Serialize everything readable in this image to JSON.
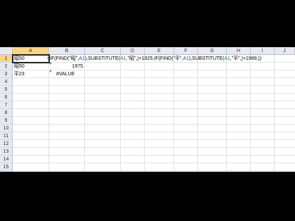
{
  "columns": [
    "A",
    "B",
    "C",
    "D",
    "E",
    "F",
    "G",
    "H",
    "I",
    "J"
  ],
  "rows": [
    "1",
    "2",
    "3",
    "4",
    "5",
    "6",
    "7",
    "8",
    "9",
    "10",
    "11",
    "12",
    "13",
    "14",
    "15",
    "16"
  ],
  "cells": {
    "A1": "昭50",
    "A2": "昭50",
    "A3": "平23",
    "B2": "1975",
    "B3": "#VALUE"
  },
  "formula": {
    "p1": "=IF(FIND(\"昭\",",
    "p2": "A1",
    "p3": "),SUBSTITUTE(",
    "p4": "A1",
    "p5": ",\"昭\",)+1925,IF(FIND(\"平\",",
    "p6": "A1",
    "p7": "),SUBSTITUTE(",
    "p8": "A1",
    "p9": ",\"平\",)+1989,))"
  },
  "active_cell": "A1",
  "colors": {
    "header_bg": "#e6eaf0",
    "active_header": "#f7d58a",
    "ref_blue": "#1f4ea8",
    "ref_green": "#1a7a2a"
  }
}
